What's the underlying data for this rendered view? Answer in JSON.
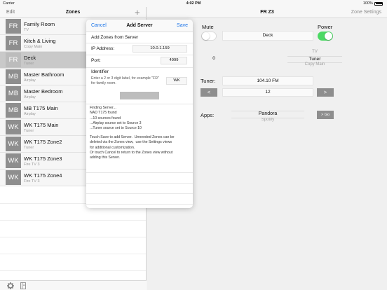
{
  "status_bar": {
    "carrier": "Carrier",
    "time": "4:02 PM",
    "battery": "100%"
  },
  "left_panel": {
    "edit_label": "Edit",
    "title": "Zones",
    "add_label": "+",
    "zones": [
      {
        "badge": "FR",
        "name": "Family Room",
        "source": "TV"
      },
      {
        "badge": "FR",
        "name": "Kitch & Living",
        "source": "Copy Main"
      },
      {
        "badge": "FR",
        "name": "Deck",
        "source": "Tuner"
      },
      {
        "badge": "MB",
        "name": "Master Bathroom",
        "source": "Airplay"
      },
      {
        "badge": "MB",
        "name": "Master Bedroom",
        "source": "Airplay"
      },
      {
        "badge": "MB",
        "name": "MB T175 Main",
        "source": "Airplay"
      },
      {
        "badge": "WK",
        "name": "WK T175 Main",
        "source": "Tuner"
      },
      {
        "badge": "WK",
        "name": "WK T175 Zone2",
        "source": "Tuner"
      },
      {
        "badge": "WK",
        "name": "WK T175 Zone3",
        "source": "Fire TV 3"
      },
      {
        "badge": "WK",
        "name": "WK T175 Zone4",
        "source": "Fire TV 3"
      }
    ]
  },
  "right_panel": {
    "title": "FR Z3",
    "settings_label": "Zone Settings",
    "mute_label": "Mute",
    "power_label": "Power",
    "zone_name_value": "Deck",
    "volume_value": "0",
    "source_picker": {
      "above": "TV",
      "selected": "Tuner",
      "below": "Copy Main"
    },
    "tuner_label": "Tuner:",
    "tuner_frequency": "104.10 FM",
    "tuner_prev": "<",
    "tuner_preset": "12",
    "tuner_next": ">",
    "apps_label": "Apps:",
    "apps_picker": {
      "selected": "Pandora",
      "below": "Spotify"
    },
    "go_label": "> Go"
  },
  "popover": {
    "cancel_label": "Cancel",
    "title": "Add Server",
    "save_label": "Save",
    "section_title": "Add Zones from Server",
    "ip_label": "IP Address:",
    "ip_value": "10.0.1.159",
    "port_label": "Port:",
    "port_value": "4999",
    "identifier_label": "Identifier",
    "identifier_help": "Enter a 2 or 3 digit label, for example \"FR\" for family room.",
    "identifier_value": "WK",
    "log_text": "Finding Server...\nNAD T175 found\n...10 sources found\n...Airplay source set to Source 3\n...Tuner source set to Source 10",
    "instructions_text": "Touch Save to add Server.  Unneeded Zones can be\ndeleted via the Zones view,  use the Settings views\nfor additional customization.\nOr touch Cancel to return to the Zones view without\nadding this Server."
  },
  "colors": {
    "accent": "#1a73e8",
    "badge": "#8e8e8e",
    "power_on": "#4cd964"
  }
}
